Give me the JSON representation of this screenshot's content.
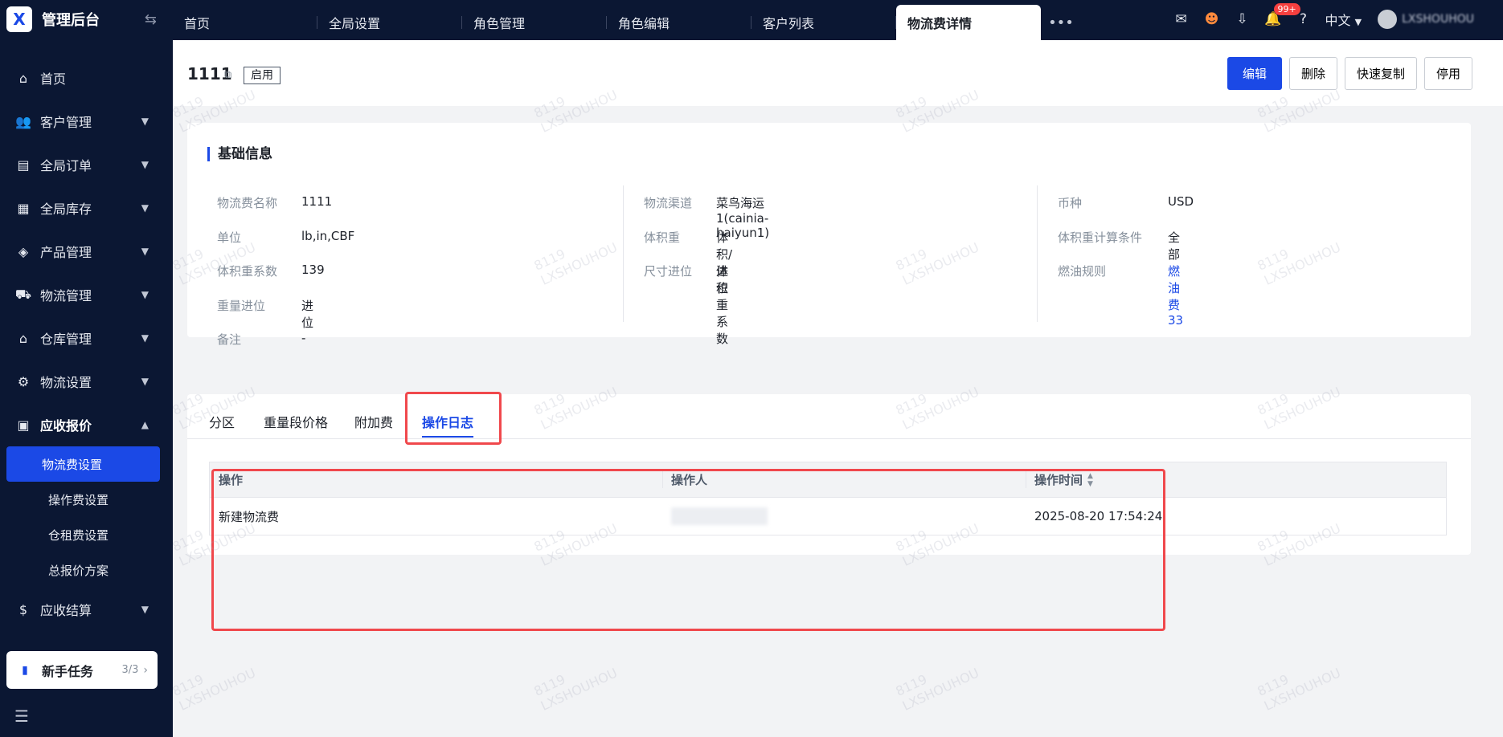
{
  "brand": {
    "logo": "X",
    "title": "管理后台",
    "toggle_icon": "swap-icon"
  },
  "sidebar": {
    "items": [
      {
        "label": "首页",
        "icon": "home-icon"
      },
      {
        "label": "客户管理",
        "icon": "users-icon"
      },
      {
        "label": "全局订单",
        "icon": "order-icon"
      },
      {
        "label": "全局库存",
        "icon": "inventory-icon"
      },
      {
        "label": "产品管理",
        "icon": "product-icon"
      },
      {
        "label": "物流管理",
        "icon": "truck-icon"
      },
      {
        "label": "仓库管理",
        "icon": "warehouse-icon"
      },
      {
        "label": "物流设置",
        "icon": "logistics-settings-icon"
      },
      {
        "label": "应收报价",
        "icon": "quote-icon"
      }
    ],
    "sub_items": [
      {
        "label": "物流费设置"
      },
      {
        "label": "操作费设置"
      },
      {
        "label": "仓租费设置"
      },
      {
        "label": "总报价方案"
      }
    ],
    "last_item": {
      "label": "应收结算",
      "icon": "settlement-icon"
    },
    "novice": {
      "label": "新手任务",
      "count": "3/3"
    }
  },
  "tabs": [
    "首页",
    "全局设置",
    "角色管理",
    "角色编辑",
    "客户列表",
    "物流费详情"
  ],
  "topbar": {
    "badge": "99+",
    "lang": "中文",
    "user": "LXSHOUHOU"
  },
  "header": {
    "title": "1111",
    "status": "启用",
    "buttons": {
      "edit": "编辑",
      "delete": "删除",
      "copy": "快速复制",
      "disable": "停用"
    }
  },
  "basic_info": {
    "title": "基础信息",
    "col1": [
      {
        "label": "物流费名称",
        "value": "1111"
      },
      {
        "label": "单位",
        "value": "lb,in,CBF"
      },
      {
        "label": "体积重系数",
        "value": "139"
      },
      {
        "label": "重量进位",
        "value": "进位"
      },
      {
        "label": "备注",
        "value": "-"
      }
    ],
    "col2": [
      {
        "label": "物流渠道",
        "value": "菜鸟海运1(cainia-haiyun1)"
      },
      {
        "label": "体积重",
        "value": "体积/体积重系数"
      },
      {
        "label": "尺寸进位",
        "value": "进位"
      }
    ],
    "col3": [
      {
        "label": "币种",
        "value": "USD"
      },
      {
        "label": "体积重计算条件",
        "value": "全部"
      },
      {
        "label": "燃油规则",
        "value": "燃油费33"
      }
    ]
  },
  "detail_tabs": [
    "分区",
    "重量段价格",
    "附加费",
    "操作日志"
  ],
  "log_table": {
    "headers": [
      "操作",
      "操作人",
      "操作时间"
    ],
    "rows": [
      {
        "action": "新建物流费",
        "operator": "",
        "time": "2025-08-20 17:54:24"
      }
    ]
  },
  "watermark": "8119\nLXSHOUHOU"
}
